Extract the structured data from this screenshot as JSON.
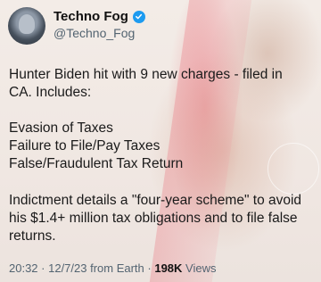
{
  "author": {
    "name": "Techno Fog",
    "handle": "@Techno_Fog"
  },
  "tweet": {
    "p1_line1": "Hunter Biden hit with 9 new charges - filed in",
    "p1_line2": "CA. Includes:",
    "list": [
      "Evasion of Taxes",
      "Failure to File/Pay Taxes",
      "False/Fraudulent Tax Return"
    ],
    "p2_line1": "Indictment details a \"four-year scheme\" to avoid",
    "p2_line2": "his $1.4+ million tax obligations and to file false",
    "p2_line3": "returns."
  },
  "meta": {
    "time": "20:32",
    "sep1": " · ",
    "date": "12/7/23 from Earth",
    "sep2": " · ",
    "views": "198K",
    "views_label": " Views"
  },
  "icons": {
    "verified_color": "#1d9bf0"
  }
}
